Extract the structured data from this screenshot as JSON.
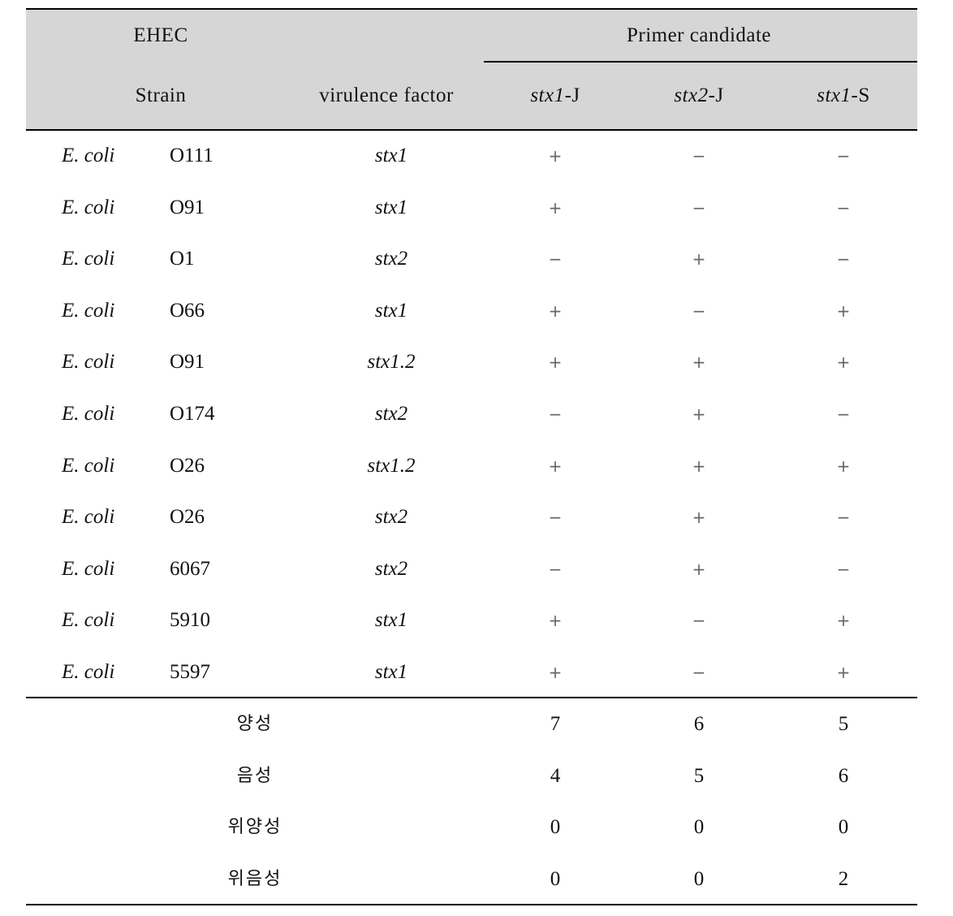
{
  "header": {
    "group_left": "EHEC",
    "group_right": "Primer candidate",
    "columns": {
      "strain": "Strain",
      "virulence_factor": "virulence factor",
      "primers": [
        {
          "gene": "stx1",
          "suffix": "-J"
        },
        {
          "gene": "stx2",
          "suffix": "-J"
        },
        {
          "gene": "stx1",
          "suffix": "-S"
        }
      ]
    }
  },
  "rows": [
    {
      "species": "E. coli",
      "strain": "O111",
      "factor": "stx1",
      "results": [
        "+",
        "−",
        "−"
      ]
    },
    {
      "species": "E. coli",
      "strain": "O91",
      "factor": "stx1",
      "results": [
        "+",
        "−",
        "−"
      ]
    },
    {
      "species": "E. coli",
      "strain": "O1",
      "factor": "stx2",
      "results": [
        "−",
        "+",
        "−"
      ]
    },
    {
      "species": "E. coli",
      "strain": "O66",
      "factor": "stx1",
      "results": [
        "+",
        "−",
        "+"
      ]
    },
    {
      "species": "E. coli",
      "strain": "O91",
      "factor": "stx1.2",
      "results": [
        "+",
        "+",
        "+"
      ]
    },
    {
      "species": "E. coli",
      "strain": "O174",
      "factor": "stx2",
      "results": [
        "−",
        "+",
        "−"
      ]
    },
    {
      "species": "E. coli",
      "strain": "O26",
      "factor": "stx1.2",
      "results": [
        "+",
        "+",
        "+"
      ]
    },
    {
      "species": "E. coli",
      "strain": "O26",
      "factor": "stx2",
      "results": [
        "−",
        "+",
        "−"
      ]
    },
    {
      "species": "E. coli",
      "strain": "6067",
      "factor": "stx2",
      "results": [
        "−",
        "+",
        "−"
      ]
    },
    {
      "species": "E. coli",
      "strain": "5910",
      "factor": "stx1",
      "results": [
        "+",
        "−",
        "+"
      ]
    },
    {
      "species": "E. coli",
      "strain": "5597",
      "factor": "stx1",
      "results": [
        "+",
        "−",
        "+"
      ]
    }
  ],
  "summary": [
    {
      "label": "양성",
      "values": [
        "7",
        "6",
        "5"
      ]
    },
    {
      "label": "음성",
      "values": [
        "4",
        "5",
        "6"
      ]
    },
    {
      "label": "위양성",
      "values": [
        "0",
        "0",
        "0"
      ]
    },
    {
      "label": "위음성",
      "values": [
        "0",
        "0",
        "2"
      ]
    }
  ]
}
